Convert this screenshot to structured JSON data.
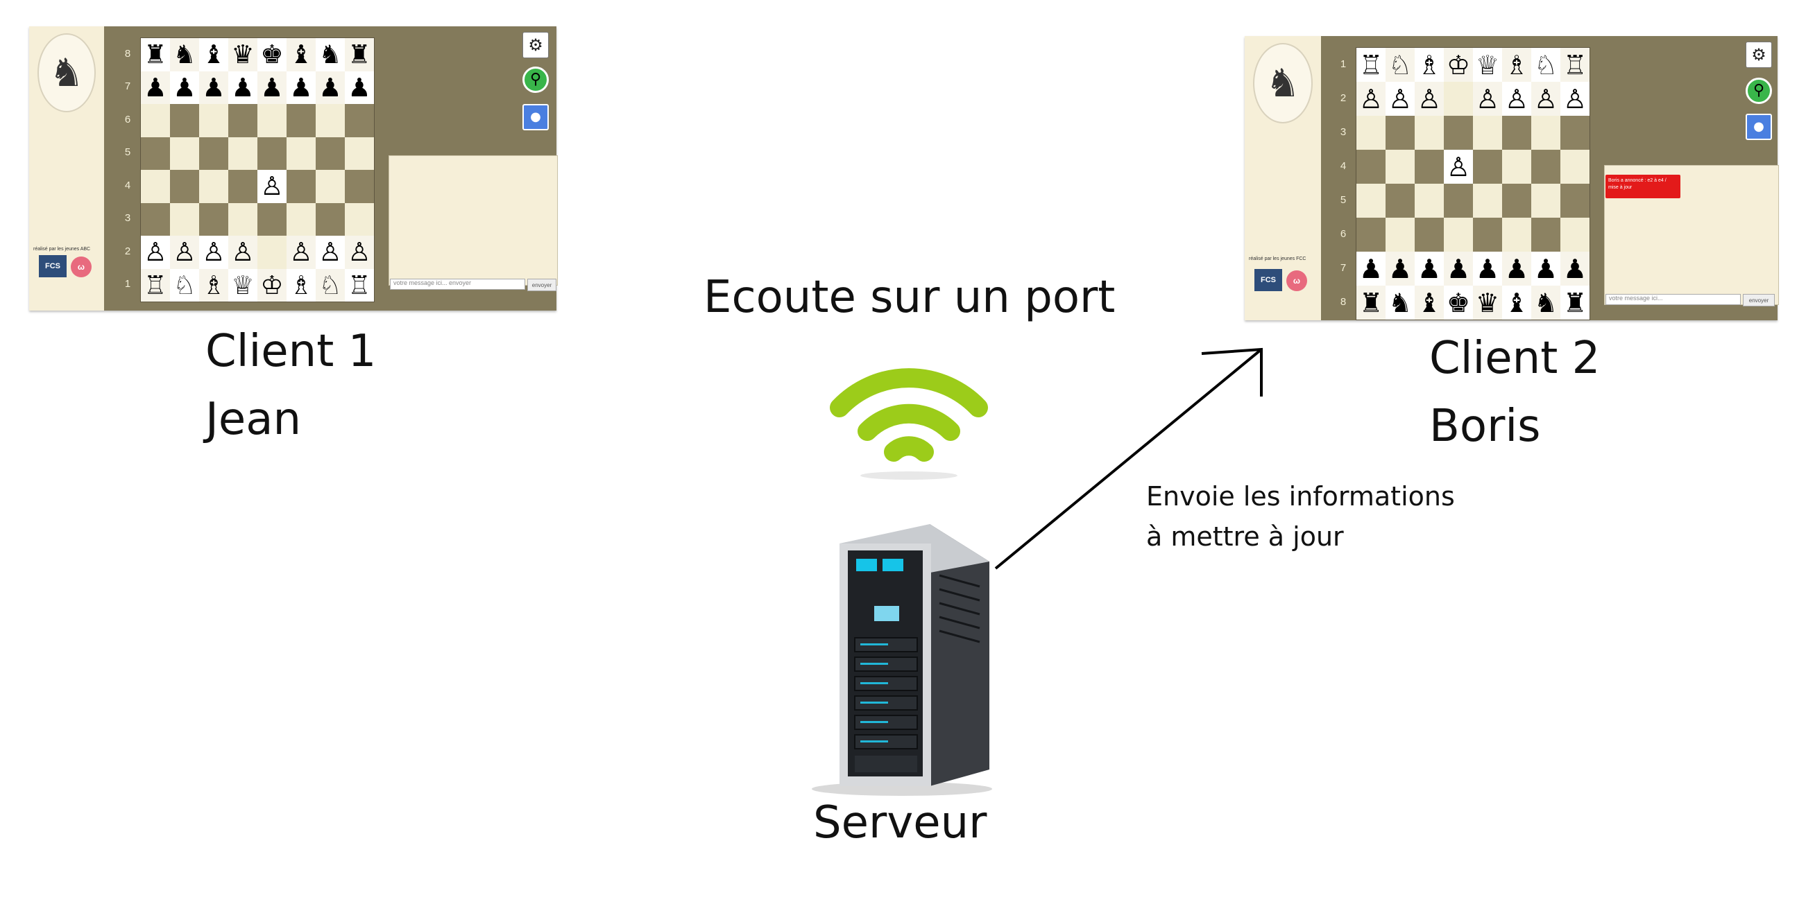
{
  "heading": "Ecoute sur un port",
  "server_label": "Serveur",
  "arrow_label_line1": "Envoie les informations",
  "arrow_label_line2": "à mettre à jour",
  "client1": {
    "name": "Client 1",
    "user": "Jean",
    "ranks": [
      "8",
      "7",
      "6",
      "5",
      "4",
      "3",
      "2",
      "1"
    ],
    "board": [
      "♜♞♝♛♚♝♞♜",
      "♟♟♟♟♟♟♟♟",
      "        ",
      "        ",
      "    ♙   ",
      "        ",
      "♙♙♙♙ ♙♙♙",
      "♖♘♗♕♔♗♘♖"
    ],
    "sponsor_text": "réalisé par les jeunes ABC",
    "fcs_label": "FCS",
    "chat_placeholder": "votre message ici... envoyer",
    "send_label": "envoyer",
    "notification": ""
  },
  "client2": {
    "name": "Client 2",
    "user": "Boris",
    "ranks": [
      "1",
      "2",
      "3",
      "4",
      "5",
      "6",
      "7",
      "8"
    ],
    "board": [
      "♖♘♗♔♕♗♘♖",
      "♙♙♙ ♙♙♙♙",
      "        ",
      "   ♙    ",
      "        ",
      "        ",
      "♟♟♟♟♟♟♟♟",
      "♜♞♝♚♛♝♞♜"
    ],
    "sponsor_text": "réalisé par les jeunes FCC",
    "fcs_label": "FCS",
    "chat_placeholder": "votre message ici...",
    "send_label": "envoyer",
    "notification": "Boris a annoncé : e2 à e4 / mise à jour"
  },
  "colors": {
    "board_dark": "#8c8262",
    "board_light": "#f3eed6",
    "panel_bg": "#837a5b",
    "wifi_green": "#9ccc1a",
    "notification_red": "#e31a1a"
  },
  "icons": [
    "gear-icon",
    "search-icon",
    "microphone-icon",
    "wifi-icon",
    "server-rack-icon",
    "arrow-icon"
  ]
}
